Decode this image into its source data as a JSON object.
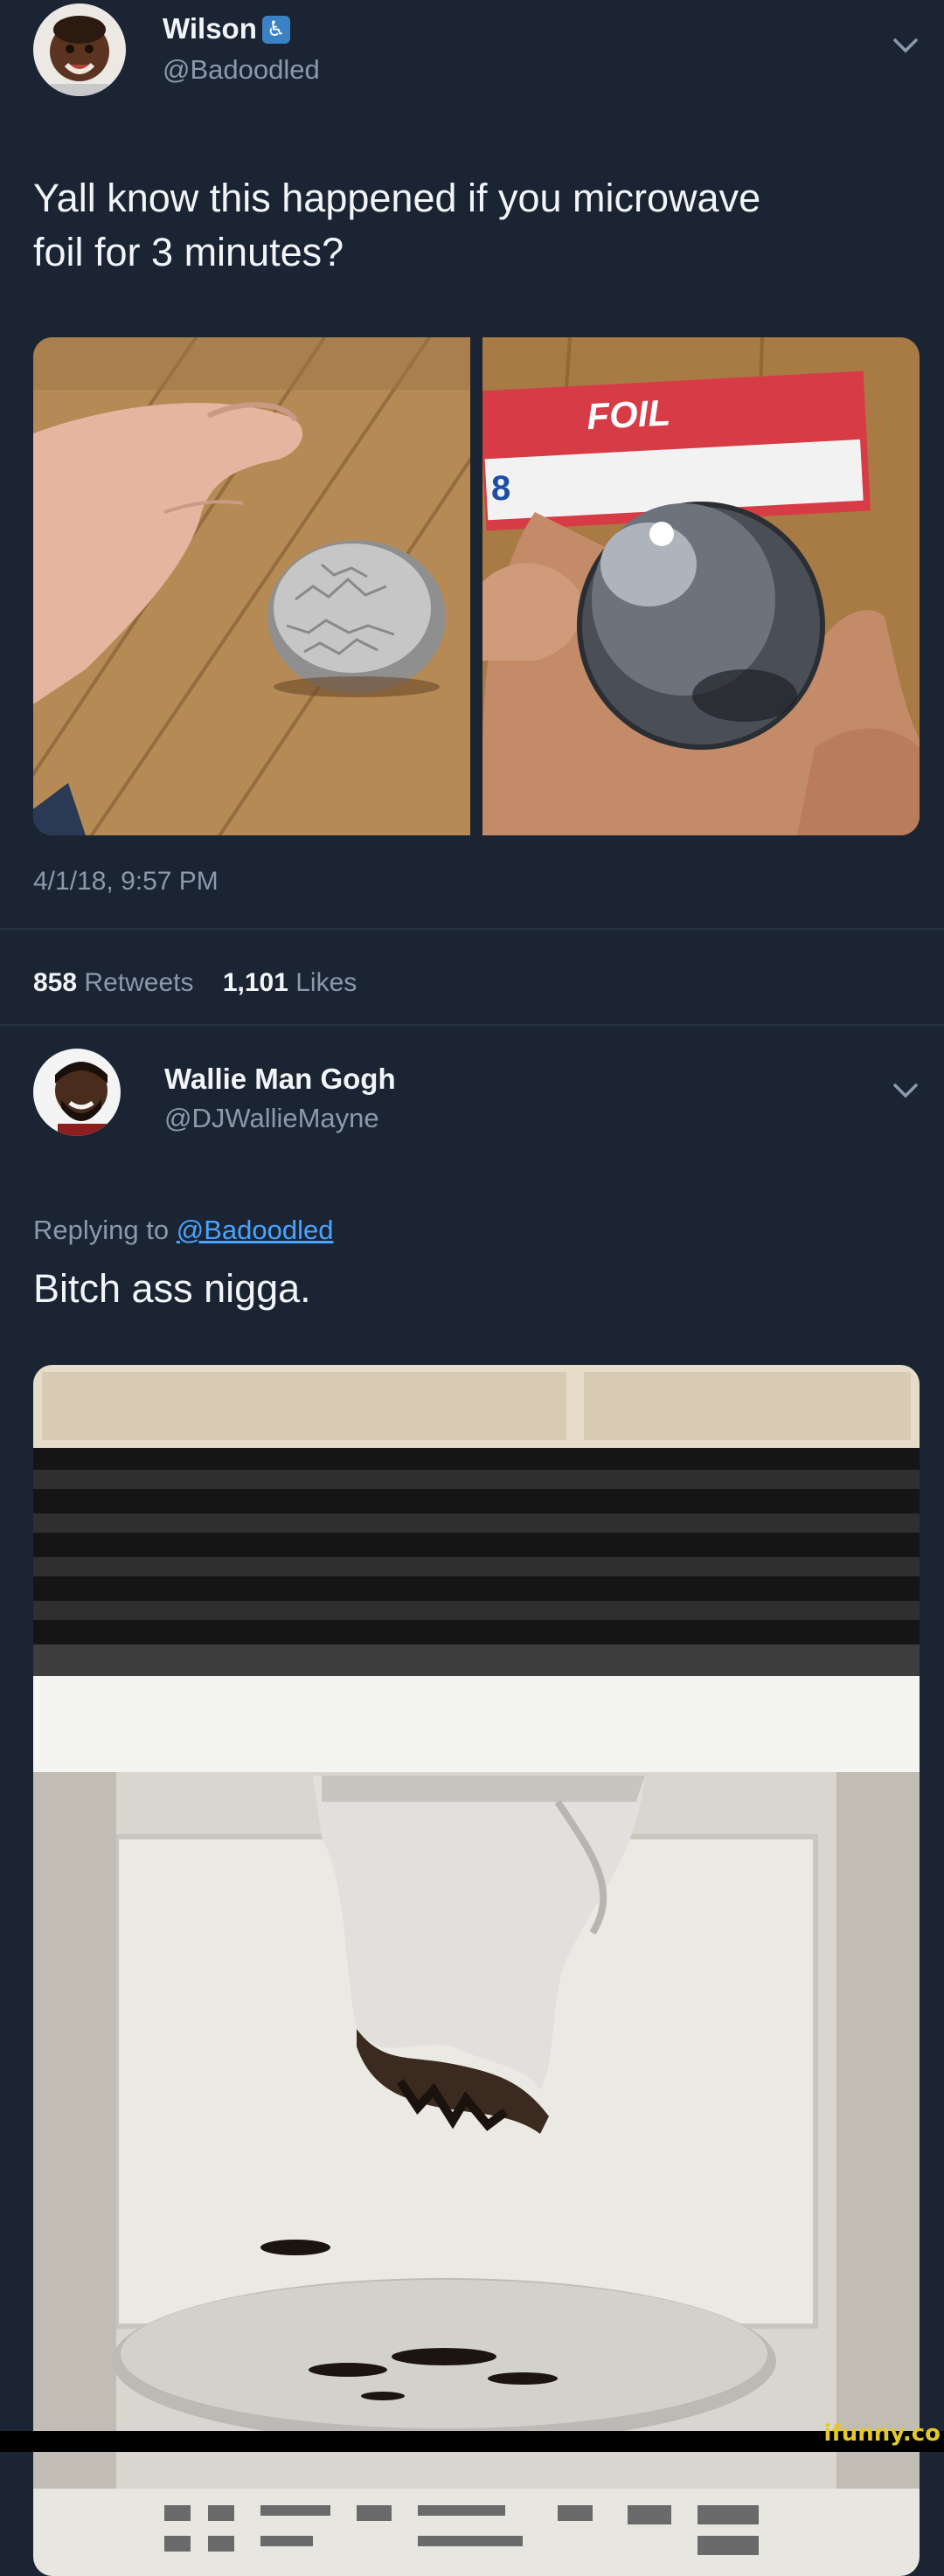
{
  "tweet1": {
    "name": "Wilson",
    "handle": "@Badoodled",
    "text_line1": "Yall know this happened if you microwave",
    "text_line2": "foil for 3 minutes?",
    "timestamp": "4/1/18, 9:57 PM",
    "retweets_count": "858",
    "retweets_label": "Retweets",
    "likes_count": "1,101",
    "likes_label": "Likes",
    "foil_box_text": "FOIL"
  },
  "tweet2": {
    "name": "Wallie Man Gogh",
    "handle": "@DJWallieMayne",
    "replying_prefix": "Replying to",
    "replying_handle": "@Badoodled",
    "text": "Bitch ass nigga."
  },
  "watermark": "ifunny.co",
  "colors": {
    "background": "#1a2433",
    "link": "#4aa3ff",
    "secondary_text": "#8a9aab"
  },
  "icons": [
    "chevron-down-icon",
    "accessibility-badge-icon"
  ]
}
